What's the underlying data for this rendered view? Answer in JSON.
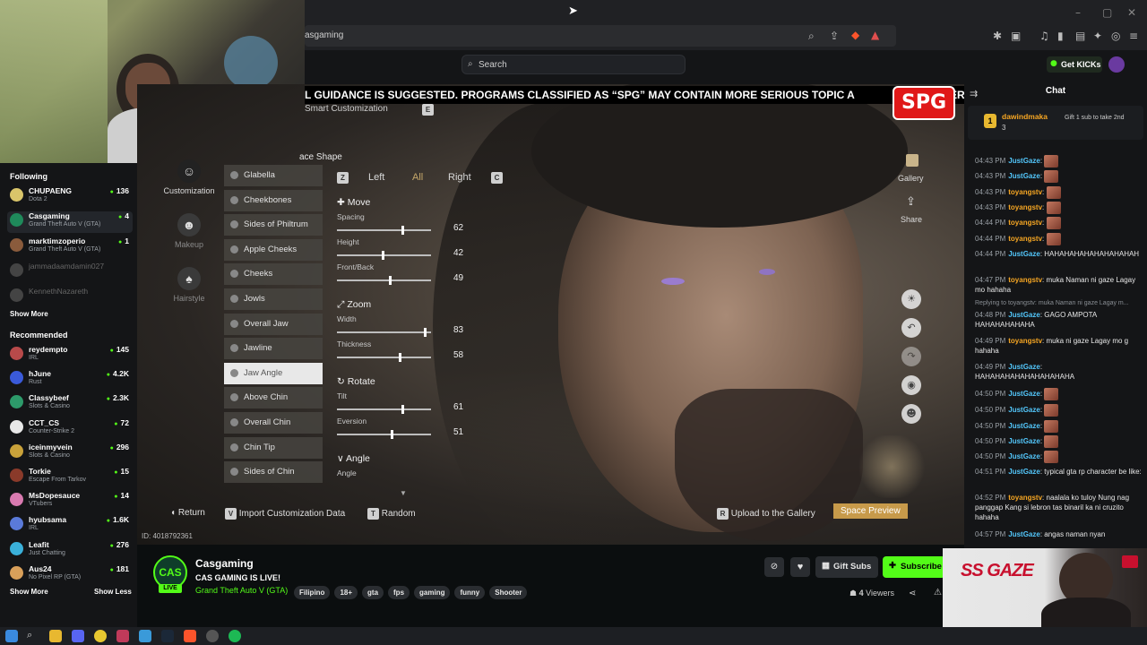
{
  "browser": {
    "url_fragment": "asgaming",
    "search_placeholder": "Search",
    "get_kicks_label": "Get KICKs"
  },
  "sidebar": {
    "following_title": "Following",
    "following": [
      {
        "name": "CHUPAENG",
        "game": "Dota 2",
        "viewers": "136",
        "color": "#d9c56a"
      },
      {
        "name": "Casgaming",
        "game": "Grand Theft Auto V (GTA)",
        "viewers": "4",
        "color": "#1f8a5b"
      },
      {
        "name": "marktimzoperio",
        "game": "Grand Theft Auto V (GTA)",
        "viewers": "1",
        "color": "#8a5b3c"
      },
      {
        "name": "jammadaamdamin027",
        "game": "",
        "viewers": "",
        "color": "#444"
      },
      {
        "name": "KennethNazareth",
        "game": "",
        "viewers": "",
        "color": "#444"
      }
    ],
    "show_more_1": "Show More",
    "recommended_title": "Recommended",
    "recommended": [
      {
        "name": "reydempto",
        "game": "IRL",
        "viewers": "145",
        "color": "#b84a4a"
      },
      {
        "name": "hJune",
        "game": "Rust",
        "viewers": "4.2K",
        "color": "#3a5ad9"
      },
      {
        "name": "Classybeef",
        "game": "Slots & Casino",
        "viewers": "2.3K",
        "color": "#2d9a6a"
      },
      {
        "name": "CCT_CS",
        "game": "Counter-Strike 2",
        "viewers": "72",
        "color": "#e8e8e8"
      },
      {
        "name": "iceinmyvein",
        "game": "Slots & Casino",
        "viewers": "296",
        "color": "#c9a23a"
      },
      {
        "name": "Torkie",
        "game": "Escape From Tarkov",
        "viewers": "15",
        "color": "#8a3a2a"
      },
      {
        "name": "MsDopesauce",
        "game": "VTubers",
        "viewers": "14",
        "color": "#d97ab0"
      },
      {
        "name": "hyubsama",
        "game": "IRL",
        "viewers": "1.6K",
        "color": "#5a7ad9"
      },
      {
        "name": "Leafit",
        "game": "Just Chatting",
        "viewers": "276",
        "color": "#3ab0d9"
      },
      {
        "name": "Aus24",
        "game": "No Pixel RP (GTA)",
        "viewers": "181",
        "color": "#d9a05a"
      }
    ],
    "show_more_2": "Show More",
    "show_less": "Show Less"
  },
  "game": {
    "warning_text": "L GUIDANCE IS SUGGESTED. PROGRAMS CLASSIFIED AS “SPG” MAY CONTAIN MORE SERIOUS TOPIC A",
    "warning_tail": "ER",
    "spg_badge": "SPG",
    "smart_customization": "Smart Customization",
    "smart_key": "E",
    "face_shape": "ace Shape",
    "left_menu": [
      {
        "label": "Customization",
        "icon": "☺"
      },
      {
        "label": "Makeup",
        "icon": "☻"
      },
      {
        "label": "Hairstyle",
        "icon": "♠"
      }
    ],
    "parts": [
      "Glabella",
      "Cheekbones",
      "Sides of Philtrum",
      "Apple Cheeks",
      "Cheeks",
      "Jowls",
      "Overall Jaw",
      "Jawline",
      "Jaw Angle",
      "Above Chin",
      "Overall Chin",
      "Chin Tip",
      "Sides of Chin"
    ],
    "seg_z": "Z",
    "seg_left": "Left",
    "seg_all": "All",
    "seg_right": "Right",
    "seg_c": "C",
    "move": {
      "title": "Move",
      "spacing": "Spacing",
      "spacing_val": "62",
      "height": "Height",
      "height_val": "42",
      "front_back": "Front/Back",
      "front_back_val": "49"
    },
    "zoom": {
      "title": "Zoom",
      "width": "Width",
      "width_val": "83",
      "thickness": "Thickness",
      "thickness_val": "58"
    },
    "rotate": {
      "title": "Rotate",
      "tilt": "Tilt",
      "tilt_val": "61",
      "eversion": "Eversion",
      "eversion_val": "51"
    },
    "angle": {
      "title": "Angle",
      "angle": "Angle"
    },
    "gallery_label": "Gallery",
    "share_label": "Share",
    "return_label": "Return",
    "import_key": "V",
    "import_label": "Import Customization Data",
    "random_key": "T",
    "random_label": "Random",
    "upload_key": "R",
    "upload_label": "Upload to the Gallery",
    "preview_label": "Preview",
    "space_label": "Space",
    "id_text": "ID: 4018792361"
  },
  "chat": {
    "title": "Chat",
    "pinned_user": "dawindmaka",
    "pinned_count": "3",
    "pinned_text": "Gift 1 sub to take 2nd",
    "messages": [
      {
        "time": "04:43 PM",
        "user": "JustGaze",
        "text": "",
        "emote": true,
        "u": 1
      },
      {
        "time": "04:43 PM",
        "user": "JustGaze",
        "text": "",
        "emote": true,
        "u": 1
      },
      {
        "time": "04:43 PM",
        "user": "toyangstv",
        "text": "",
        "emote": true,
        "u": 2
      },
      {
        "time": "04:43 PM",
        "user": "toyangstv",
        "text": "",
        "emote": true,
        "u": 2
      },
      {
        "time": "04:44 PM",
        "user": "toyangstv",
        "text": "",
        "emote": true,
        "u": 2
      },
      {
        "time": "04:44 PM",
        "user": "toyangstv",
        "text": "",
        "emote": true,
        "u": 2
      },
      {
        "time": "04:44 PM",
        "user": "JustGaze",
        "text": "HAHAHAHAHAHAHAHAHAH",
        "emote": false,
        "u": 1
      },
      {
        "time": "04:47 PM",
        "user": "toyangstv",
        "text": "muka Naman ni gaze Lagay mo hahaha",
        "emote": false,
        "u": 2
      }
    ],
    "reply_note": "Replying to toyangstv: muka Naman ni gaze Lagay m...",
    "messages2": [
      {
        "time": "04:48 PM",
        "user": "JustGaze",
        "text": "GAGO AMPOTA HAHAHAHAHAHA",
        "emote": false,
        "u": 1
      },
      {
        "time": "04:49 PM",
        "user": "toyangstv",
        "text": "muka ni gaze Lagay mo g hahaha",
        "emote": false,
        "u": 2
      },
      {
        "time": "04:49 PM",
        "user": "JustGaze",
        "text": "HAHAHAHAHAHAHAHAHAHA",
        "emote": false,
        "u": 1
      },
      {
        "time": "04:50 PM",
        "user": "JustGaze",
        "text": "",
        "emote": true,
        "u": 1
      },
      {
        "time": "04:50 PM",
        "user": "JustGaze",
        "text": "",
        "emote": true,
        "u": 1
      },
      {
        "time": "04:50 PM",
        "user": "JustGaze",
        "text": "",
        "emote": true,
        "u": 1
      },
      {
        "time": "04:50 PM",
        "user": "JustGaze",
        "text": "",
        "emote": true,
        "u": 1
      },
      {
        "time": "04:50 PM",
        "user": "JustGaze",
        "text": "",
        "emote": true,
        "u": 1
      },
      {
        "time": "04:51 PM",
        "user": "JustGaze",
        "text": "typical gta rp character be like:",
        "emote": false,
        "u": 1
      },
      {
        "time": "04:52 PM",
        "user": "toyangstv",
        "text": "naalala ko tuloy Nung nag panggap Kang si lebron tas binaril ka ni cruzito hahaha",
        "emote": false,
        "u": 2
      },
      {
        "time": "04:57 PM",
        "user": "JustGaze",
        "text": "angas naman nyan",
        "emote": false,
        "u": 1
      }
    ]
  },
  "stream": {
    "avatar_text": "CAS",
    "live_label": "LIVE",
    "channel_name": "Casgaming",
    "title": "CAS GAMING IS LIVE!",
    "category": "Grand Theft Auto V (GTA)",
    "tags": [
      "Filipino",
      "18+",
      "gta",
      "fps",
      "gaming",
      "funny",
      "Shooter"
    ],
    "gift_subs_label": "Gift Subs",
    "subscribe_label": "Subscribe",
    "viewers_count": "4",
    "viewers_label": "Viewers",
    "gaze_brand": "SS GAZE"
  },
  "colors": {
    "kick_green": "#53fc18",
    "spg_red": "#e01818"
  }
}
